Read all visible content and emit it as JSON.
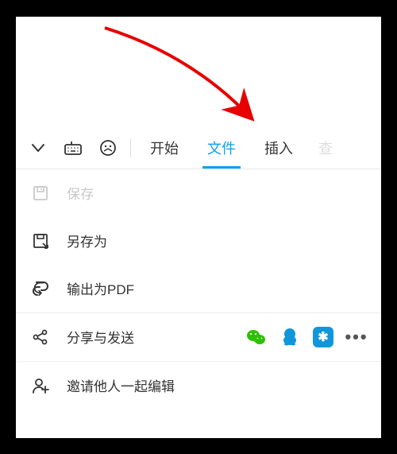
{
  "tabs": {
    "start": "开始",
    "file": "文件",
    "insert": "插入",
    "cutoff": "查"
  },
  "menu": {
    "save": "保存",
    "save_as": "另存为",
    "export_pdf": "输出为PDF",
    "share": "分享与发送",
    "invite": "邀请他人一起编辑"
  },
  "colors": {
    "accent": "#0aa1f1",
    "wechat": "#2dc100",
    "qq": "#1296db"
  }
}
